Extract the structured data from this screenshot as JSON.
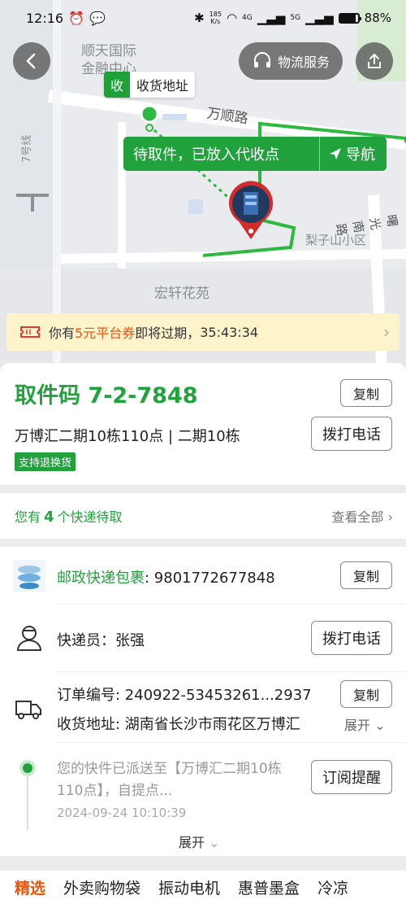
{
  "status_bar": {
    "time": "12:16",
    "net_speed_value": "185",
    "net_speed_unit": "K/s",
    "signal_1": "4G",
    "signal_2": "5G",
    "battery": "88%",
    "battery_level": 0.88
  },
  "map": {
    "labels": {
      "building": "顺天国际\n金融中心",
      "road_wanshun": "万顺路",
      "road_7": "7号线",
      "lizishan": "梨子山小区",
      "hongxuan": "宏轩花苑",
      "road_right": "曙光南路"
    },
    "receive_tag": {
      "badge": "收",
      "label": "收货地址"
    },
    "pickup_status": "待取件，已放入代收点",
    "navigate_label": "导航"
  },
  "header": {
    "logistics_label": "物流服务"
  },
  "coupon": {
    "prefix": "你有",
    "amount": "5元平台券",
    "suffix": "即将过期，",
    "countdown": "35:43:34"
  },
  "pickup": {
    "code_label": "取件码",
    "code": "7-2-7848",
    "copy_label": "复制",
    "station": "万博汇二期10栋110点 | 二期10栋",
    "call_label": "拨打电话",
    "support_tag": "支持退换货"
  },
  "pending": {
    "prefix": "您有",
    "count": "4",
    "suffix": "个快递待取",
    "view_all": "查看全部"
  },
  "parcel": {
    "carrier": "邮政快递包裹",
    "tracking_no": ": 9801772677848",
    "copy_label": "复制",
    "courier_label": "快递员：",
    "courier_name": "张强",
    "call_label": "拨打电话",
    "order_label": "订单编号: ",
    "order_no": "240922-53453261...2937",
    "order_copy_label": "复制",
    "address_label": "收货地址: ",
    "address": "湖南省长沙市雨花区万博汇",
    "address_expand": "展开",
    "latest_event": "您的快件已派送至【万博汇二期10栋110点】，自提点...",
    "latest_time": "2024-09-24 10:10:39",
    "subscribe_label": "订阅提醒",
    "timeline_expand": "展开"
  },
  "bottom_tabs": [
    "精选",
    "外卖购物袋",
    "振动电机",
    "惠普墨盒",
    "冷凉"
  ],
  "colors": {
    "accent_green": "#22a23c",
    "coupon_orange": "#e8560c",
    "coupon_bg": "#fdf4cc"
  },
  "icons": {
    "back": "back-arrow-icon",
    "headset": "headset-icon",
    "share": "share-icon",
    "navigate": "navigate-arrow-icon",
    "ticket": "ticket-icon",
    "courier": "person-icon",
    "truck": "truck-icon"
  }
}
